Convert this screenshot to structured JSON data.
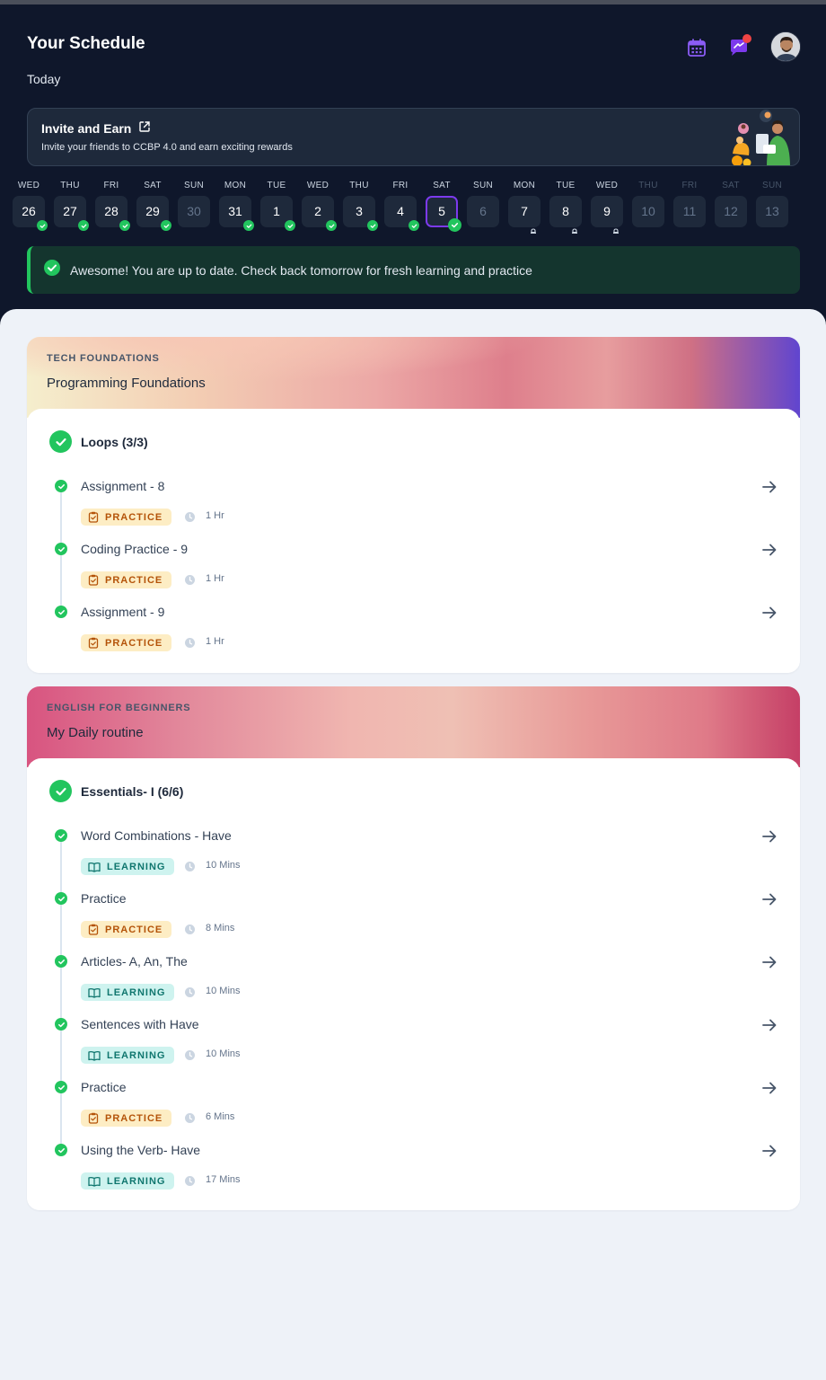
{
  "header": {
    "title": "Your Schedule",
    "subtitle": "Today",
    "icons": {
      "calendar": "calendar-icon",
      "chat": "chat-notification-icon",
      "avatar": "user-avatar"
    }
  },
  "invite": {
    "title": "Invite and Earn",
    "description": "Invite your friends to CCBP 4.0 and earn exciting rewards"
  },
  "days": [
    {
      "label": "WED",
      "date": "26",
      "status": "done"
    },
    {
      "label": "THU",
      "date": "27",
      "status": "done"
    },
    {
      "label": "FRI",
      "date": "28",
      "status": "done"
    },
    {
      "label": "SAT",
      "date": "29",
      "status": "done"
    },
    {
      "label": "SUN",
      "date": "30",
      "status": "rest"
    },
    {
      "label": "MON",
      "date": "31",
      "status": "done"
    },
    {
      "label": "TUE",
      "date": "1",
      "status": "done"
    },
    {
      "label": "WED",
      "date": "2",
      "status": "done"
    },
    {
      "label": "THU",
      "date": "3",
      "status": "done"
    },
    {
      "label": "FRI",
      "date": "4",
      "status": "done"
    },
    {
      "label": "SAT",
      "date": "5",
      "status": "selected"
    },
    {
      "label": "SUN",
      "date": "6",
      "status": "rest"
    },
    {
      "label": "MON",
      "date": "7",
      "status": "locked"
    },
    {
      "label": "TUE",
      "date": "8",
      "status": "locked"
    },
    {
      "label": "WED",
      "date": "9",
      "status": "locked"
    },
    {
      "label": "THU",
      "date": "10",
      "status": "future"
    },
    {
      "label": "FRI",
      "date": "11",
      "status": "future"
    },
    {
      "label": "SAT",
      "date": "12",
      "status": "future"
    },
    {
      "label": "SUN",
      "date": "13",
      "status": "future"
    }
  ],
  "banner": {
    "text": "Awesome! You are up to date. Check back tomorrow for fresh learning and practice"
  },
  "colors": {
    "accent_green": "#22c55e",
    "selected_border": "#7c3aed",
    "header_bg": "#0f172b",
    "practice_tag": "#fdedc4",
    "learning_tag": "#cef3ef"
  },
  "courses": [
    {
      "category": "TECH FOUNDATIONS",
      "name": "Programming Foundations",
      "section": "Loops (3/3)",
      "items": [
        {
          "title": "Assignment - 8",
          "tag": "PRACTICE",
          "duration": "1 Hr"
        },
        {
          "title": "Coding Practice - 9",
          "tag": "PRACTICE",
          "duration": "1 Hr"
        },
        {
          "title": "Assignment - 9",
          "tag": "PRACTICE",
          "duration": "1 Hr"
        }
      ]
    },
    {
      "category": "ENGLISH FOR BEGINNERS",
      "name": "My Daily routine",
      "section": "Essentials- I (6/6)",
      "items": [
        {
          "title": "Word Combinations - Have",
          "tag": "LEARNING",
          "duration": "10 Mins"
        },
        {
          "title": "Practice",
          "tag": "PRACTICE",
          "duration": "8 Mins"
        },
        {
          "title": "Articles- A, An, The",
          "tag": "LEARNING",
          "duration": "10 Mins"
        },
        {
          "title": "Sentences with Have",
          "tag": "LEARNING",
          "duration": "10 Mins"
        },
        {
          "title": "Practice",
          "tag": "PRACTICE",
          "duration": "6 Mins"
        },
        {
          "title": "Using the Verb- Have",
          "tag": "LEARNING",
          "duration": "17 Mins"
        }
      ]
    }
  ]
}
